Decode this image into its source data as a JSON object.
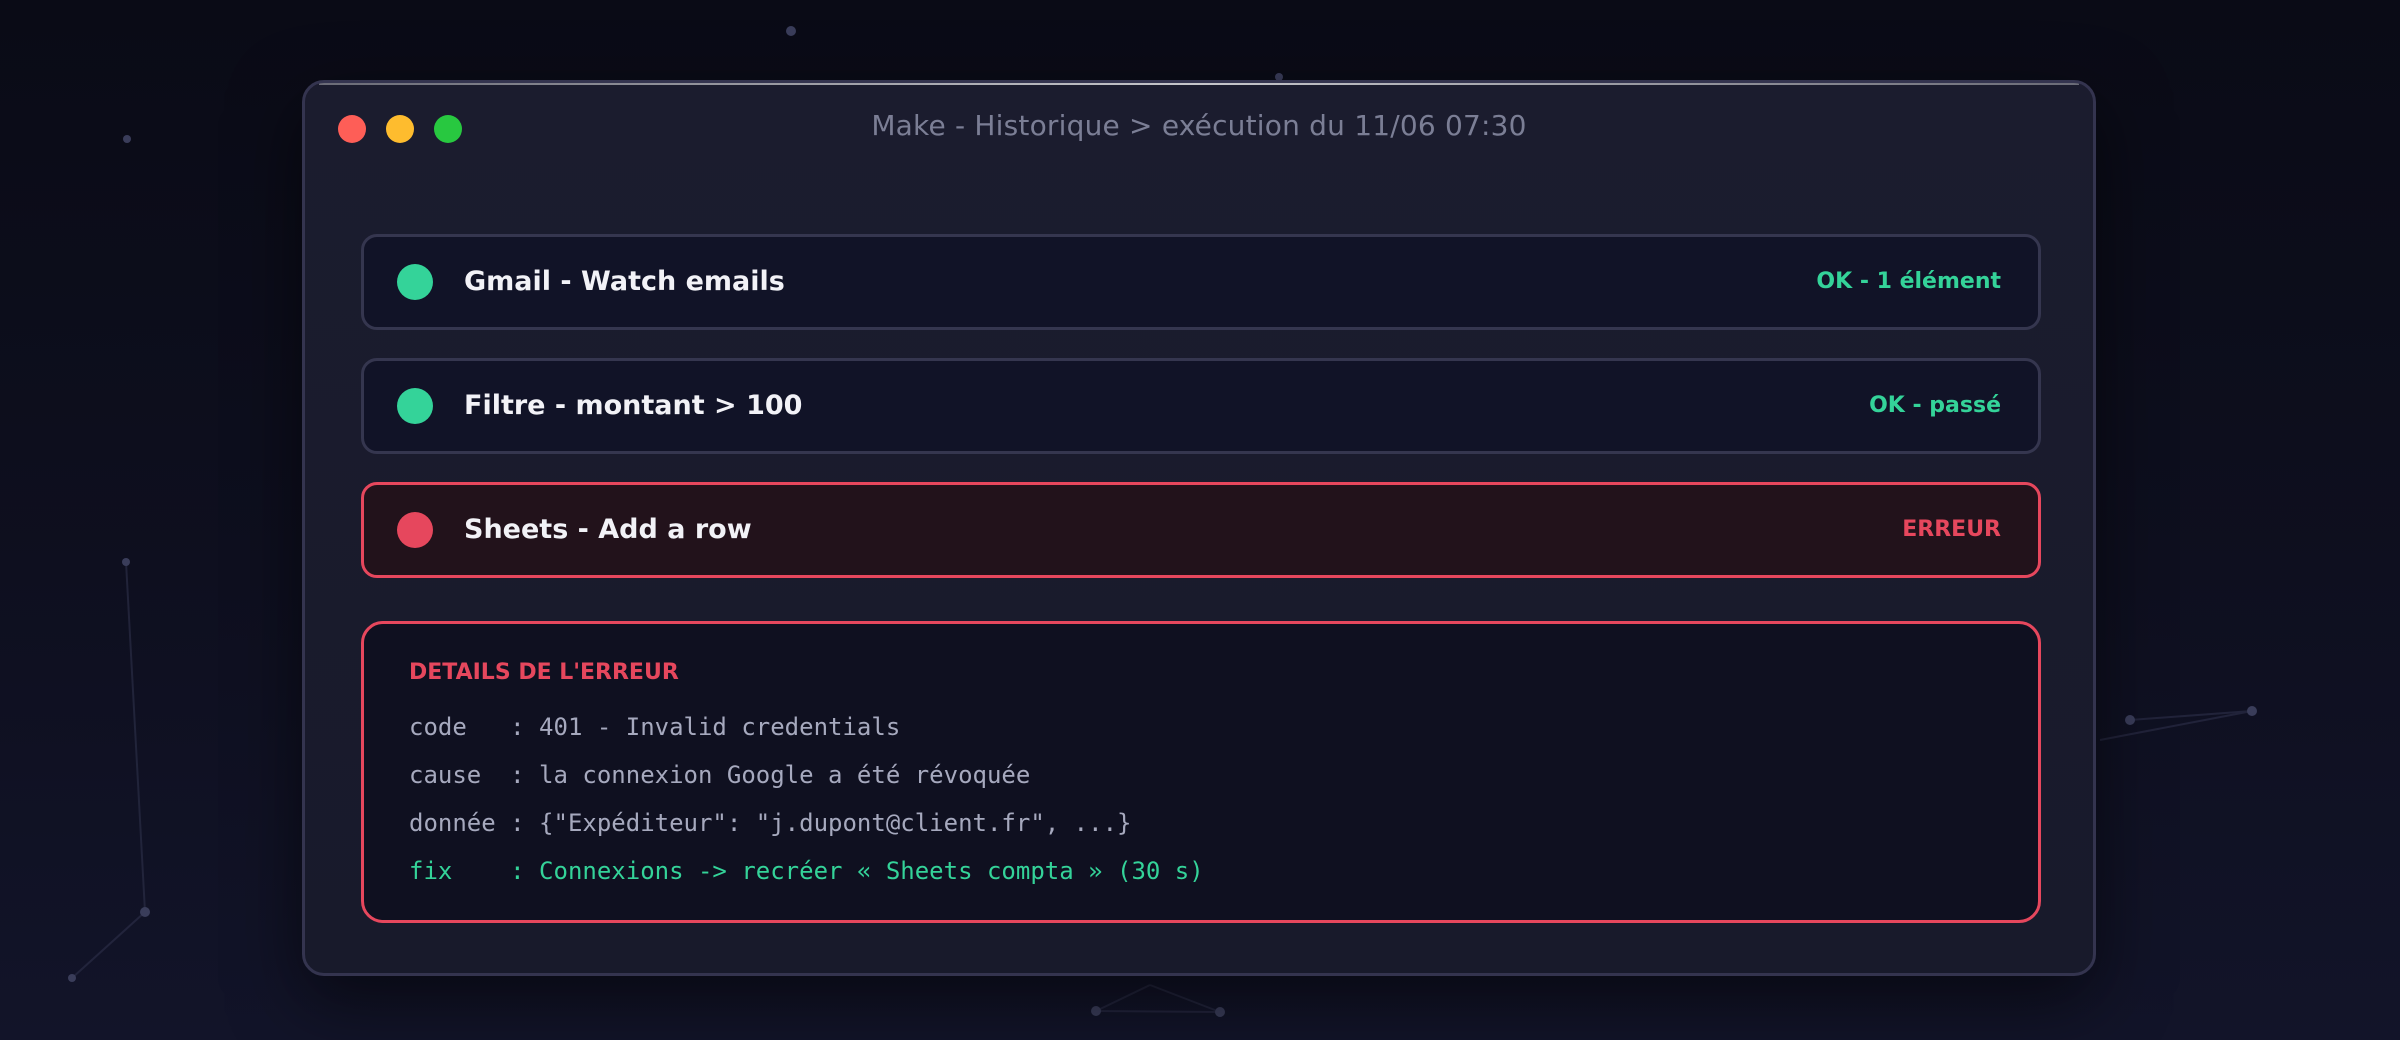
{
  "window": {
    "title": "Make - Historique > exécution du 11/06 07:30"
  },
  "colors": {
    "ok": "#34d399",
    "error": "#e6475d",
    "step_border": "#35364f",
    "fix_text": "#34d399"
  },
  "steps": [
    {
      "label": "Gmail - Watch emails",
      "status": "OK - 1 élément",
      "state": "ok"
    },
    {
      "label": "Filtre - montant > 100",
      "status": "OK - passé",
      "state": "ok"
    },
    {
      "label": "Sheets - Add a row",
      "status": "ERREUR",
      "state": "error"
    }
  ],
  "error_details": {
    "title": "DETAILS DE L'ERREUR",
    "lines": [
      "code   : 401 - Invalid credentials",
      "cause  : la connexion Google a été révoquée",
      "donnée : {\"Expéditeur\": \"j.dupont@client.fr\", ...}",
      "fix    : Connexions -> recréer « Sheets compta » (30 s)"
    ]
  }
}
